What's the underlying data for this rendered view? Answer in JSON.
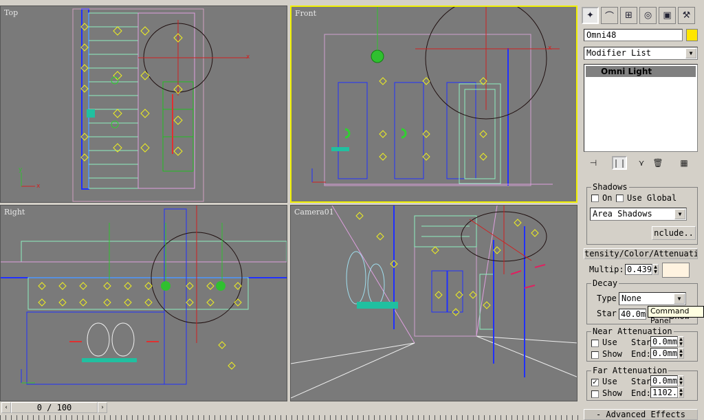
{
  "viewports": [
    {
      "label": "Top"
    },
    {
      "label": "Front"
    },
    {
      "label": "Right"
    },
    {
      "label": "Camera01"
    }
  ],
  "command_panel": {
    "tabs": [
      "create-icon",
      "modify-icon",
      "hierarchy-icon",
      "motion-icon",
      "display-icon",
      "utilities-icon"
    ],
    "object_name": "Omni48",
    "object_color": "#ffe600",
    "modifier_list": "Modifier List",
    "stack_item": "Omni Light",
    "tooltip": "Command Panel"
  },
  "shadows": {
    "title": "Shadows",
    "on_label": "On",
    "use_global_label": "Use Global",
    "shadow_type": "Area Shadows",
    "include_button": "nclude.."
  },
  "intensity": {
    "rollout_title": "tensity/Color/Attenuati",
    "multiplier_label": "Multip:",
    "multiplier_value": "0.439",
    "light_color": "#fff3e0"
  },
  "decay": {
    "title": "Decay",
    "type_label": "Type",
    "type_value": "None",
    "start_label": "Star",
    "start_value": "40.0m",
    "show_label": "Show"
  },
  "near_attenuation": {
    "title": "Near Attenuation",
    "use_label": "Use",
    "show_label": "Show",
    "start_label": "Star",
    "start_value": "0.0mm",
    "end_label": "End:",
    "end_value": "0.0mm"
  },
  "far_attenuation": {
    "title": "Far Attenuation",
    "use_label": "Use",
    "use_checked": "✓",
    "show_label": "Show",
    "start_label": "Star",
    "start_value": "0.0mm",
    "end_label": "End:",
    "end_value": "1102.0"
  },
  "advanced_effects": "-  Advanced Effects",
  "timeline": {
    "position": "0 / 100"
  }
}
